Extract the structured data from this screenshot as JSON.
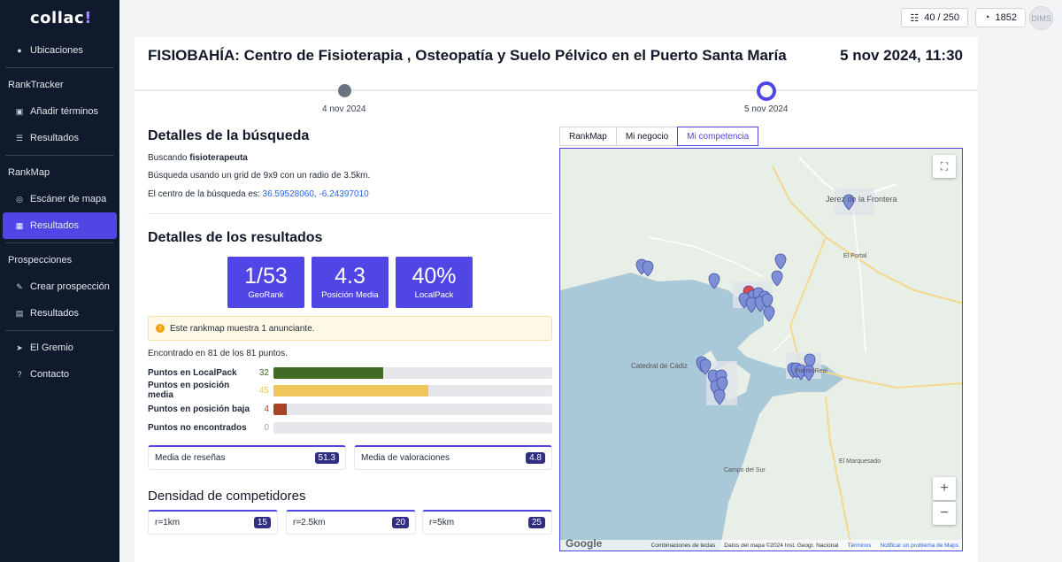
{
  "app": {
    "logo_text": "collac",
    "logo_accent": "!"
  },
  "sidebar": {
    "items": [
      {
        "label": "Ubicaciones",
        "icon": "map-pin-icon"
      },
      {
        "label": "Añadir términos",
        "icon": "add-terms-icon"
      },
      {
        "label": "Resultados",
        "icon": "list-icon"
      },
      {
        "label": "Escáner de mapa",
        "icon": "target-icon"
      },
      {
        "label": "Resultados",
        "icon": "grid-icon",
        "active": true
      },
      {
        "label": "Crear prospección",
        "icon": "pin-icon"
      },
      {
        "label": "Resultados",
        "icon": "document-icon"
      },
      {
        "label": "El Gremio",
        "icon": "send-icon"
      },
      {
        "label": "Contacto",
        "icon": "help-icon"
      }
    ],
    "sections": [
      "RankTracker",
      "RankMap",
      "Prospecciones"
    ]
  },
  "topbar": {
    "credits": "40 / 250",
    "points": "1852",
    "avatar": "DIMS"
  },
  "main": {
    "title": "FISIOBAHÍA: Centro de Fisioterapia , Osteopatía y Suelo Pélvico en el Puerto Santa María",
    "date": "5 nov 2024, 11:30",
    "timeline": [
      "4 nov 2024",
      "5 nov 2024"
    ],
    "search_details": {
      "heading": "Detalles de la búsqueda",
      "searching_prefix": "Buscando ",
      "keyword": "fisioterapeuta",
      "grid_text": "Búsqueda usando un grid de 9x9 con un radio de 3.5km.",
      "center_prefix": "El centro de la búsqueda es: ",
      "center_coords": "36.59528060, -6.24397010"
    },
    "results": {
      "heading": "Detalles de los resultados",
      "stats": [
        {
          "value": "1/53",
          "label": "GeoRank"
        },
        {
          "value": "4.3",
          "label": "Posición Media"
        },
        {
          "value": "40%",
          "label": "LocalPack"
        }
      ],
      "alert": "Este rankmap muestra 1 anunciante.",
      "found": "Encontrado en 81 de los 81 puntos.",
      "rows": [
        {
          "label": "Puntos en LocalPack",
          "count": "32",
          "fraction": 0.395,
          "color": "#3f6b24"
        },
        {
          "label": "Puntos en posición media",
          "count": "45",
          "fraction": 0.556,
          "color": "#efc65a"
        },
        {
          "label": "Puntos en posición baja",
          "count": "4",
          "fraction": 0.049,
          "color": "#a8432a"
        },
        {
          "label": "Puntos no encontrados",
          "count": "0",
          "fraction": 0,
          "color": "#9ca3af"
        }
      ],
      "metrics": [
        {
          "label": "Media de reseñas",
          "value": "51.3"
        },
        {
          "label": "Media de valoraciones",
          "value": "4.8"
        }
      ]
    },
    "density": {
      "heading": "Densidad de competidores",
      "items": [
        {
          "label": "r=1km",
          "value": "15"
        },
        {
          "label": "r=2.5km",
          "value": "20"
        },
        {
          "label": "r=5km",
          "value": "25"
        }
      ]
    },
    "map_tabs": [
      {
        "label": "RankMap"
      },
      {
        "label": "Mi negocio"
      },
      {
        "label": "Mi competencia",
        "active": true
      }
    ],
    "map": {
      "places": [
        "Jerez de la Frontera",
        "Catedral de Cádiz",
        "El Portal",
        "El Marquesado",
        "Campo del Sur",
        "Puerto Real"
      ],
      "footer": [
        "Combinaciones de teclas",
        "Datos del mapa ©2024 Inst. Geogr. Nacional",
        "Términos",
        "Notificar un problema de Maps"
      ],
      "google": "Google",
      "zoom_in": "+",
      "zoom_out": "−"
    }
  }
}
